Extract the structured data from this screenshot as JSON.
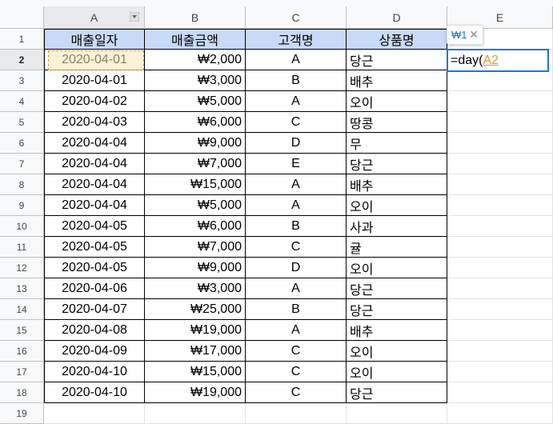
{
  "columns": [
    "A",
    "B",
    "C",
    "D",
    "E"
  ],
  "rows": [
    "1",
    "2",
    "3",
    "4",
    "5",
    "6",
    "7",
    "8",
    "9",
    "10",
    "11",
    "12",
    "13",
    "14",
    "15",
    "16",
    "17",
    "18",
    "19"
  ],
  "table": {
    "headers": [
      "매출일자",
      "매출금액",
      "고객명",
      "상품명"
    ],
    "records": [
      {
        "date": "2020-04-01",
        "amount": "₩2,000",
        "customer": "A",
        "product": "당근"
      },
      {
        "date": "2020-04-01",
        "amount": "₩3,000",
        "customer": "B",
        "product": "배추"
      },
      {
        "date": "2020-04-02",
        "amount": "₩5,000",
        "customer": "A",
        "product": "오이"
      },
      {
        "date": "2020-04-03",
        "amount": "₩6,000",
        "customer": "C",
        "product": "땅콩"
      },
      {
        "date": "2020-04-04",
        "amount": "₩9,000",
        "customer": "D",
        "product": "무"
      },
      {
        "date": "2020-04-04",
        "amount": "₩7,000",
        "customer": "E",
        "product": "당근"
      },
      {
        "date": "2020-04-04",
        "amount": "₩15,000",
        "customer": "A",
        "product": "배추"
      },
      {
        "date": "2020-04-04",
        "amount": "₩5,000",
        "customer": "A",
        "product": "오이"
      },
      {
        "date": "2020-04-05",
        "amount": "₩6,000",
        "customer": "B",
        "product": "사과"
      },
      {
        "date": "2020-04-05",
        "amount": "₩7,000",
        "customer": "C",
        "product": "귤"
      },
      {
        "date": "2020-04-05",
        "amount": "₩9,000",
        "customer": "D",
        "product": "오이"
      },
      {
        "date": "2020-04-06",
        "amount": "₩3,000",
        "customer": "A",
        "product": "당근"
      },
      {
        "date": "2020-04-07",
        "amount": "₩25,000",
        "customer": "B",
        "product": "당근"
      },
      {
        "date": "2020-04-08",
        "amount": "₩19,000",
        "customer": "A",
        "product": "배추"
      },
      {
        "date": "2020-04-09",
        "amount": "₩17,000",
        "customer": "C",
        "product": "오이"
      },
      {
        "date": "2020-04-10",
        "amount": "₩15,000",
        "customer": "C",
        "product": "오이"
      },
      {
        "date": "2020-04-10",
        "amount": "₩19,000",
        "customer": "C",
        "product": "당근"
      }
    ]
  },
  "editor": {
    "formula_prefix": "=day(",
    "formula_ref": "A2",
    "hint_value": "₩1"
  },
  "icons": {
    "dropdown": "chevron-down-icon",
    "close": "close-icon"
  },
  "colors": {
    "header_fill": "#c9daf8",
    "selection_border": "#1a73e8",
    "reference_color": "#e69138"
  }
}
